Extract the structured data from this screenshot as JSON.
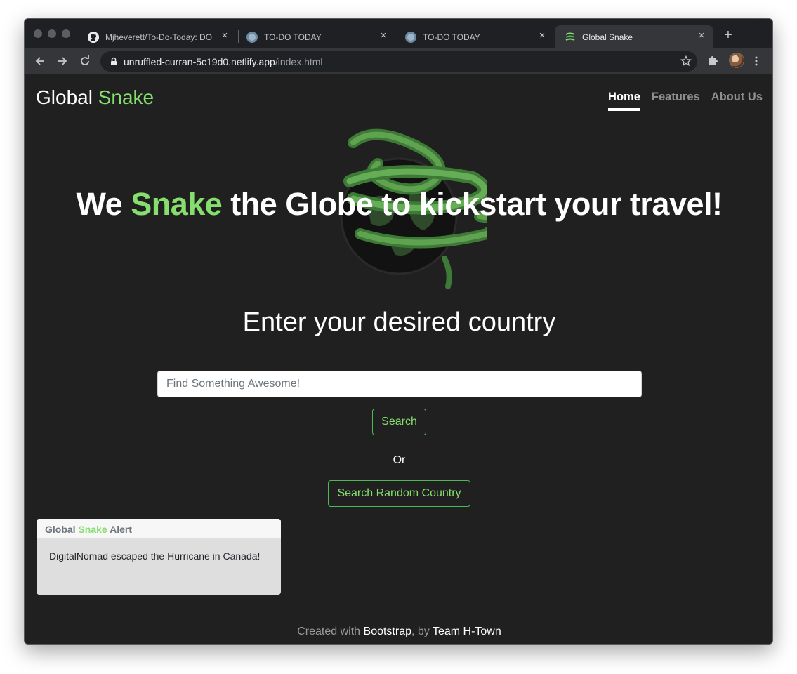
{
  "browser": {
    "tabs": [
      {
        "title": "Mjheverett/To-Do-Today: DO",
        "active": false
      },
      {
        "title": "TO-DO TODAY",
        "active": false
      },
      {
        "title": "TO-DO TODAY",
        "active": false
      },
      {
        "title": "Global Snake",
        "active": true
      }
    ],
    "url_host": "unruffled-curran-5c19d0.netlify.app",
    "url_path": "/index.html"
  },
  "navbar": {
    "brand_prefix": "Global",
    "brand_highlight": "Snake",
    "links": [
      "Home",
      "Features",
      "About Us"
    ],
    "active_link": "Home"
  },
  "hero": {
    "before": "We",
    "highlight": "Snake",
    "after": "the Globe to kickstart your travel!"
  },
  "search": {
    "heading": "Enter your desired country",
    "placeholder": "Find Something Awesome!",
    "button_label": "Search",
    "or_text": "Or",
    "random_label": "Search Random Country"
  },
  "alert": {
    "title_prefix": "Global",
    "title_highlight": "Snake",
    "title_suffix": "Alert",
    "message": "DigitalNomad escaped the Hurricane in Canada!"
  },
  "footer": {
    "prefix": "Created with",
    "link1": "Bootstrap",
    "middle": ", by",
    "link2": "Team H-Town"
  },
  "colors": {
    "accent_green": "#86de6e",
    "page_background": "#202020"
  }
}
